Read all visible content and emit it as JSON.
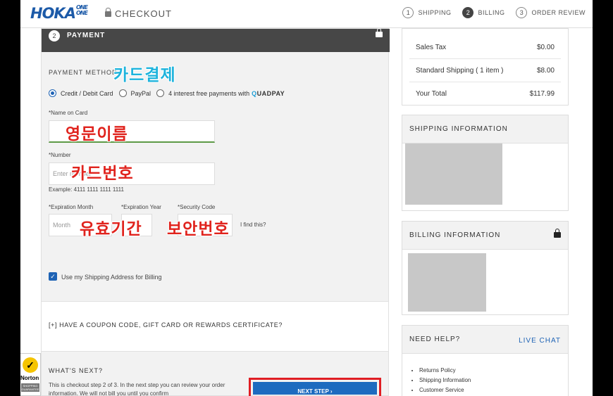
{
  "header": {
    "logo_main": "HOKA",
    "logo_sub_1": "ONE",
    "logo_sub_2": "ONE",
    "checkout_label": "CHECKOUT",
    "steps": [
      {
        "num": "1",
        "label": "SHIPPING"
      },
      {
        "num": "2",
        "label": "BILLING"
      },
      {
        "num": "3",
        "label": "ORDER REVIEW"
      }
    ]
  },
  "payment": {
    "step_num": "2",
    "title": "PAYMENT",
    "method_label": "PAYMENT METHOD",
    "options": {
      "card": "Credit / Debit Card",
      "paypal": "PayPal",
      "quadpay_prefix": "4 interest free payments with",
      "quadpay_q": "Q",
      "quadpay_rest": "UADPAY"
    },
    "name_label": "*Name on Card",
    "number_label": "*Number",
    "number_placeholder": "Enter number",
    "number_example": "Example: 4111 1111 1111 1111",
    "exp_month_label": "*Expiration Month",
    "exp_year_label": "*Expiration Year",
    "security_label": "*Security Code",
    "month_placeholder": "Month",
    "where_find": "I find this?",
    "use_shipping_label": "Use my Shipping Address for Billing",
    "coupon_label": "[+] HAVE A COUPON CODE, GIFT CARD OR REWARDS CERTIFICATE?",
    "whats_next_title": "WHAT'S NEXT?",
    "whats_next_text": "This is checkout step 2 of 3. In the next step you can review your order information. We will not bill you until you confirm",
    "next_button": "NEXT STEP  ›"
  },
  "annotations": {
    "card_payment": "카드결제",
    "english_name": "영문이름",
    "card_number": "카드번호",
    "expiry": "유효기간",
    "security": "보안번호"
  },
  "summary": {
    "rows": [
      {
        "label": "Sales Tax",
        "value": "$0.00"
      },
      {
        "label": "Standard Shipping ( 1 item )",
        "value": "$8.00"
      },
      {
        "label": "Your Total",
        "value": "$117.99"
      }
    ]
  },
  "shipping_info": {
    "title": "SHIPPING INFORMATION"
  },
  "billing_info": {
    "title": "BILLING INFORMATION"
  },
  "help": {
    "title": "NEED HELP?",
    "live_chat": "LIVE CHAT",
    "links": [
      "Returns Policy",
      "Shipping Information",
      "Customer Service"
    ]
  },
  "norton": {
    "name": "Norton",
    "seal_text": "SHOPPING GUARANTEE"
  },
  "colors": {
    "accent": "#1e63b5",
    "header_bar": "#474747",
    "highlight": "#e01e24"
  }
}
